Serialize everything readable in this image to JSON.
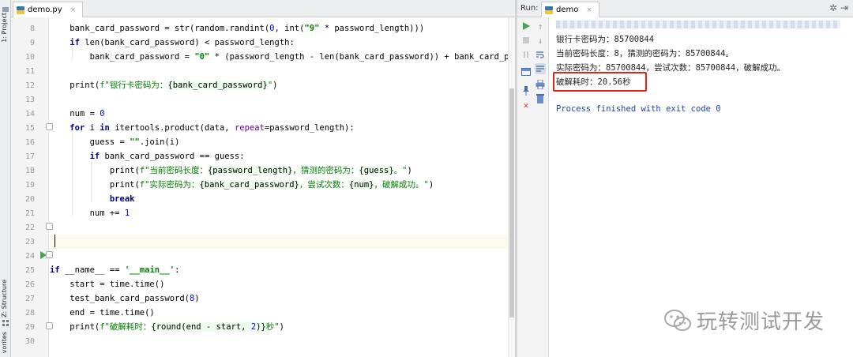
{
  "tool_strip": {
    "project_tab": "1: Project",
    "structure_tab": "Z: Structure",
    "favorites_tab": "vorites"
  },
  "editor": {
    "tab_label": "demo.py",
    "tab_close": "×",
    "line_numbers": [
      "8",
      "9",
      "10",
      "11",
      "12",
      "13",
      "14",
      "15",
      "16",
      "17",
      "18",
      "19",
      "20",
      "21",
      "22",
      "23",
      "24",
      "25",
      "26",
      "27",
      "28",
      "29",
      "30"
    ]
  },
  "run_panel": {
    "label": "Run:",
    "tab_label": "demo",
    "tab_close": "×",
    "gear": "✲",
    "hide": "⇥",
    "console_lines": [
      "银行卡密码为：85700844",
      "当前密码长度：8，猜测的密码为：85700844。",
      "实际密码为：85700844，尝试次数：85700844，破解成功。",
      "破解耗时：20.56秒",
      "",
      "Process finished with exit code 0"
    ]
  },
  "watermark": {
    "text": "玩转测试开发"
  },
  "colors": {
    "keyword": "#000080",
    "number": "#0000ff",
    "string": "#008000",
    "highlight_box": "#e0241c",
    "exit_text": "#2040b0"
  }
}
